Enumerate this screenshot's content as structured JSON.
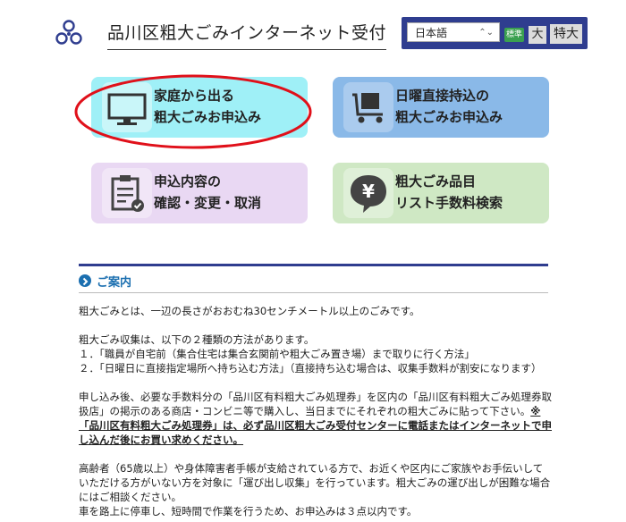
{
  "header": {
    "title": "品川区粗大ごみインターネット受付",
    "language": "日本語",
    "size_standard": "標準",
    "size_large": "大",
    "size_xlarge": "特大"
  },
  "tiles": [
    {
      "line1": "家庭から出る",
      "line2": "粗大ごみお申込み",
      "icon": "monitor-icon"
    },
    {
      "line1": "日曜直接持込の",
      "line2": "粗大ごみお申込み",
      "icon": "cart-icon"
    },
    {
      "line1": "申込内容の",
      "line2": "確認・変更・取消",
      "icon": "clipboard-icon"
    },
    {
      "line1": "粗大ごみ品目",
      "line2": "リスト手数料検索",
      "icon": "yen-bubble-icon"
    }
  ],
  "notice": {
    "heading": "ご案内",
    "p1": "粗大ごみとは、一辺の長さがおおむね30センチメートル以上のごみです。",
    "p2": "粗大ごみ収集は、以下の２種類の方法があります。",
    "p2_item1": "１．「職員が自宅前（集合住宅は集合玄関前や粗大ごみ置き場）まで取りに行く方法」",
    "p2_item2": "２．「日曜日に直接指定場所へ持ち込む方法」（直接持ち込む場合は、収集手数料が割安になります）",
    "p3_a": "申し込み後、必要な手数料分の「品川区有料粗大ごみ処理券」を区内の「品川区有料粗大ごみ処理券取扱店」の掲示のある商店・コンビニ等で購入し、当日までにそれぞれの粗大ごみに貼って下さい。",
    "p3_b": "※「品川区有料粗大ごみ処理券」は、必ず品川区粗大ごみ受付センターに電話またはインターネットで申し込んだ後にお買い求めください。",
    "p4": "高齢者（65歳以上）や身体障害者手帳が支給されている方で、お近くや区内にご家族やお手伝いしていただける方がいない方を対象に「運び出し収集」を行っています。粗大ごみの運び出しが困難な場合にはご相談ください。",
    "p5": "車を路上に停車し、短時間で作業を行うため、お申込みは３点以内です。"
  }
}
